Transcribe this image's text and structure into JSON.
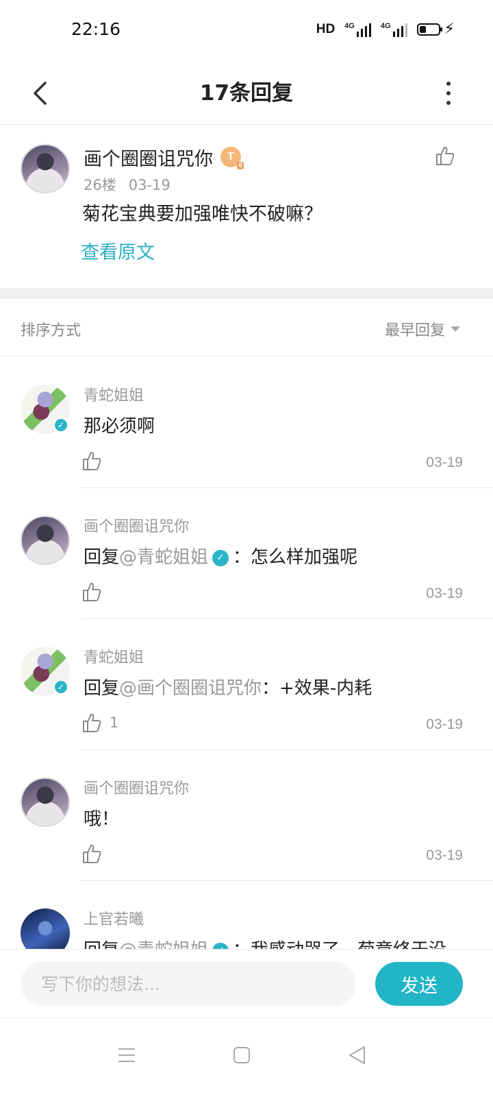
{
  "status_bar": {
    "time": "22:16",
    "network_label": "HD",
    "signal1_label": "4G",
    "signal2_label": "4G"
  },
  "header": {
    "title": "17条回复",
    "back_icon": "chevron-left-icon",
    "more_icon": "vertical-dots-icon"
  },
  "original_post": {
    "author": "画个圈圈诅咒你",
    "level_badge": "T",
    "level_number": "6",
    "floor": "26楼",
    "date": "03-19",
    "text": "菊花宝典要加强唯快不破嘛？",
    "view_original": "查看原文"
  },
  "sort": {
    "label": "排序方式",
    "selected": "最早回复"
  },
  "replies": [
    {
      "name": "青蛇姐姐",
      "text": "那必须啊",
      "likes": "",
      "date": "03-19",
      "verified": true
    },
    {
      "name": "画个圈圈诅咒你",
      "prefix": "回复",
      "mention": "@青蛇姐姐",
      "mention_verified": true,
      "text": "：怎么样加强呢",
      "likes": "",
      "date": "03-19"
    },
    {
      "name": "青蛇姐姐",
      "prefix": "回复",
      "mention": "@画个圈圈诅咒你",
      "text": "：+效果-内耗",
      "likes": "1",
      "date": "03-19",
      "verified": true
    },
    {
      "name": "画个圈圈诅咒你",
      "text": "哦！",
      "likes": "",
      "date": "03-19"
    },
    {
      "name": "上官若曦",
      "prefix": "回复",
      "mention": "@青蛇姐姐",
      "mention_verified": true,
      "text": "：我感动哭了，菊章终于没",
      "likes": "",
      "date": ""
    }
  ],
  "composer": {
    "placeholder": "写下你的想法...",
    "send_label": "发送"
  },
  "colors": {
    "accent": "#21b5c5",
    "link": "#2ab0c4",
    "muted": "#999999"
  }
}
